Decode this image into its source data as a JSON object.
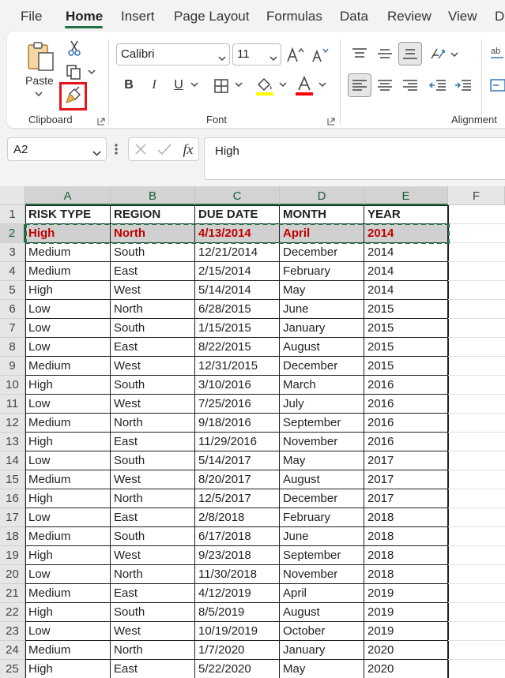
{
  "menu": {
    "tabs": [
      "File",
      "Home",
      "Insert",
      "Page Layout",
      "Formulas",
      "Data",
      "Review",
      "View",
      "D"
    ],
    "active_index": 1
  },
  "ribbon": {
    "clipboard": {
      "label": "Clipboard",
      "paste_label": "Paste"
    },
    "font": {
      "label": "Font",
      "font_name": "Calibri",
      "font_size": "11",
      "bold": "B",
      "italic": "I",
      "underline": "U"
    },
    "alignment": {
      "label": "Alignment"
    },
    "colors": {
      "highlight": "#ffff00",
      "font_color": "#ff0000",
      "accent": "#217346",
      "callout": "#e3161c"
    }
  },
  "formula_bar": {
    "name_box": "A2",
    "fx_label": "fx",
    "content": "High"
  },
  "sheet": {
    "columns": [
      "A",
      "B",
      "C",
      "D",
      "E",
      "F"
    ],
    "selected_row": 2,
    "rows": [
      {
        "num": "1",
        "cells": [
          "RISK TYPE",
          "REGION",
          "DUE DATE",
          "MONTH",
          "YEAR"
        ]
      },
      {
        "num": "2",
        "cells": [
          "High",
          "North",
          "4/13/2014",
          "April",
          "2014"
        ]
      },
      {
        "num": "3",
        "cells": [
          "Medium",
          "South",
          "12/21/2014",
          "December",
          "2014"
        ]
      },
      {
        "num": "4",
        "cells": [
          "Medium",
          "East",
          "2/15/2014",
          "February",
          "2014"
        ]
      },
      {
        "num": "5",
        "cells": [
          "High",
          "West",
          "5/14/2014",
          "May",
          "2014"
        ]
      },
      {
        "num": "6",
        "cells": [
          "Low",
          "North",
          "6/28/2015",
          "June",
          "2015"
        ]
      },
      {
        "num": "7",
        "cells": [
          "Low",
          "South",
          "1/15/2015",
          "January",
          "2015"
        ]
      },
      {
        "num": "8",
        "cells": [
          "Low",
          "East",
          "8/22/2015",
          "August",
          "2015"
        ]
      },
      {
        "num": "9",
        "cells": [
          "Medium",
          "West",
          "12/31/2015",
          "December",
          "2015"
        ]
      },
      {
        "num": "10",
        "cells": [
          "High",
          "South",
          "3/10/2016",
          "March",
          "2016"
        ]
      },
      {
        "num": "11",
        "cells": [
          "Low",
          "West",
          "7/25/2016",
          "July",
          "2016"
        ]
      },
      {
        "num": "12",
        "cells": [
          "Medium",
          "North",
          "9/18/2016",
          "September",
          "2016"
        ]
      },
      {
        "num": "13",
        "cells": [
          "High",
          "East",
          "11/29/2016",
          "November",
          "2016"
        ]
      },
      {
        "num": "14",
        "cells": [
          "Low",
          "South",
          "5/14/2017",
          "May",
          "2017"
        ]
      },
      {
        "num": "15",
        "cells": [
          "Medium",
          "West",
          "8/20/2017",
          "August",
          "2017"
        ]
      },
      {
        "num": "16",
        "cells": [
          "High",
          "North",
          "12/5/2017",
          "December",
          "2017"
        ]
      },
      {
        "num": "17",
        "cells": [
          "Low",
          "East",
          "2/8/2018",
          "February",
          "2018"
        ]
      },
      {
        "num": "18",
        "cells": [
          "Medium",
          "South",
          "6/17/2018",
          "June",
          "2018"
        ]
      },
      {
        "num": "19",
        "cells": [
          "High",
          "West",
          "9/23/2018",
          "September",
          "2018"
        ]
      },
      {
        "num": "20",
        "cells": [
          "Low",
          "North",
          "11/30/2018",
          "November",
          "2018"
        ]
      },
      {
        "num": "21",
        "cells": [
          "Medium",
          "East",
          "4/12/2019",
          "April",
          "2019"
        ]
      },
      {
        "num": "22",
        "cells": [
          "High",
          "South",
          "8/5/2019",
          "August",
          "2019"
        ]
      },
      {
        "num": "23",
        "cells": [
          "Low",
          "West",
          "10/19/2019",
          "October",
          "2019"
        ]
      },
      {
        "num": "24",
        "cells": [
          "Medium",
          "North",
          "1/7/2020",
          "January",
          "2020"
        ]
      },
      {
        "num": "25",
        "cells": [
          "High",
          "East",
          "5/22/2020",
          "May",
          "2020"
        ]
      }
    ]
  }
}
